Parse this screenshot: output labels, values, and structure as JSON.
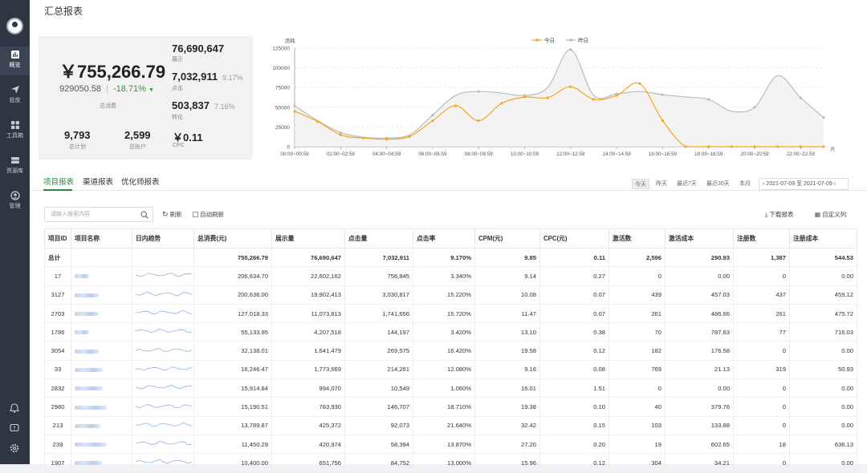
{
  "nav": {
    "items": [
      {
        "label": "概览",
        "icon": "bar-chart-icon"
      },
      {
        "label": "投放",
        "icon": "send-icon"
      },
      {
        "label": "工具箱",
        "icon": "grid-icon"
      },
      {
        "label": "资源库",
        "icon": "database-icon"
      },
      {
        "label": "管理",
        "icon": "user-circle-icon"
      }
    ]
  },
  "header": {
    "title": "汇总报表"
  },
  "kpi": {
    "total_spend": "￥755,266.79",
    "compare_value": "929050.58",
    "separator": "|",
    "change": "-18.71%",
    "spend_label": "总消费",
    "impressions": "76,690,647",
    "impressions_label": "展示",
    "clicks": "7,032,911",
    "clicks_pct": "9.17%",
    "clicks_label": "点击",
    "conversions": "503,837",
    "conversions_pct": "7.16%",
    "conversions_label": "转化",
    "plans": "9,793",
    "plans_label": "总计划",
    "accounts": "2,599",
    "accounts_label": "总账户",
    "cpc": "￥0.11",
    "cpc_label": "CPC"
  },
  "chart_data": {
    "type": "line",
    "ylabel": "消耗",
    "xlabel": "时间",
    "ylim": [
      0,
      125000
    ],
    "yticks": [
      "0",
      "25000",
      "50000",
      "75000",
      "100000",
      "125000"
    ],
    "categories": [
      "00:00~00:59",
      "01:00~01:59",
      "02:00~02:59",
      "03:00~03:59",
      "04:00~04:59",
      "05:00~05:59",
      "06:00~06:59",
      "07:00~07:59",
      "08:00~08:59",
      "09:00~09:59",
      "10:00~10:59",
      "11:00~11:59",
      "12:00~12:59",
      "13:00~13:59",
      "14:00~14:59",
      "15:00~15:59",
      "16:00~16:59",
      "17:00~17:59",
      "18:00~18:59",
      "19:00~19:59",
      "20:00~20:59",
      "21:00~21:59",
      "22:00~22:59",
      "23:00~23:59"
    ],
    "xtick_labels": [
      "00:00~00:59",
      "02:00~02:59",
      "04:00~04:59",
      "06:00~06:59",
      "08:00~08:59",
      "10:00~10:59",
      "12:00~12:59",
      "14:00~14:59",
      "16:00~16:59",
      "18:00~18:59",
      "20:00~20:59",
      "22:00~22:59"
    ],
    "legend_position": "top-center",
    "series": [
      {
        "name": "今日",
        "color": "#f5a623",
        "values": [
          45000,
          32000,
          15000,
          11000,
          9500,
          13000,
          33000,
          52000,
          33000,
          55000,
          63000,
          62000,
          76000,
          60000,
          65000,
          80000,
          33000,
          0,
          0,
          0,
          0,
          0,
          0,
          0
        ]
      },
      {
        "name": "昨日",
        "color": "#bbbbbb",
        "values": [
          52000,
          33000,
          18000,
          12000,
          11000,
          15000,
          40000,
          65000,
          70000,
          68000,
          65000,
          75000,
          123000,
          65000,
          67000,
          70000,
          66000,
          63000,
          60000,
          45000,
          50000,
          90000,
          62000,
          37000
        ]
      }
    ]
  },
  "tabs": [
    "项目报表",
    "渠道报表",
    "优化师报表"
  ],
  "ranges": [
    "今天",
    "昨天",
    "最近7天",
    "最近30天",
    "本月"
  ],
  "date_range": "2021-07-09 至 2021-07-09",
  "toolbar": {
    "search_placeholder": "请输入搜索内容",
    "refresh": "刷新",
    "auto_refresh": "自动刷新",
    "download": "下载报表",
    "custom_columns": "自定义列"
  },
  "table": {
    "headers": [
      "项目ID",
      "项目名称",
      "日内趋势",
      "总消费(元)",
      "展示量",
      "点击量",
      "点击率",
      "CPM(元)",
      "CPC(元)",
      "激活数",
      "激活成本",
      "注册数",
      "注册成本"
    ],
    "total": [
      "总计",
      "",
      "",
      "755,266.79",
      "76,690,647",
      "7,032,911",
      "9.170%",
      "9.85",
      "0.11",
      "2,596",
      "290.93",
      "1,387",
      "544.53"
    ],
    "rows": [
      [
        "17",
        "",
        "",
        "206,634.70",
        "22,602,162",
        "756,845",
        "3.340%",
        "9.14",
        "0.27",
        "0",
        "0.00",
        "0",
        "0.00"
      ],
      [
        "3127",
        "",
        "",
        "200,636.00",
        "19,902,413",
        "3,030,817",
        "15.220%",
        "10.08",
        "0.07",
        "439",
        "457.03",
        "437",
        "459.12"
      ],
      [
        "2703",
        "",
        "",
        "127,018.33",
        "11,073,813",
        "1,741,656",
        "15.720%",
        "11.47",
        "0.07",
        "261",
        "486.66",
        "261",
        "475.72"
      ],
      [
        "1786",
        "",
        "",
        "55,133.95",
        "4,207,518",
        "144,197",
        "3.420%",
        "13.10",
        "0.38",
        "70",
        "787.63",
        "77",
        "716.03"
      ],
      [
        "3054",
        "",
        "",
        "32,138.01",
        "1,641,479",
        "269,575",
        "16.420%",
        "19.58",
        "0.12",
        "182",
        "176.58",
        "0",
        "0.00"
      ],
      [
        "33",
        "",
        "",
        "16,246.47",
        "1,773,669",
        "214,261",
        "12.080%",
        "9.16",
        "0.08",
        "769",
        "21.13",
        "319",
        "50.93"
      ],
      [
        "2832",
        "",
        "",
        "15,914.84",
        "994,070",
        "10,549",
        "1.060%",
        "16.01",
        "1.51",
        "0",
        "0.00",
        "0",
        "0.00"
      ],
      [
        "2980",
        "",
        "",
        "15,190.51",
        "783,930",
        "146,707",
        "18.710%",
        "19.38",
        "0.10",
        "40",
        "379.76",
        "0",
        "0.00"
      ],
      [
        "213",
        "",
        "",
        "13,789.87",
        "425,372",
        "92,073",
        "21.640%",
        "32.42",
        "0.15",
        "103",
        "133.88",
        "0",
        "0.00"
      ],
      [
        "239",
        "",
        "",
        "11,450.29",
        "420,974",
        "58,394",
        "13.870%",
        "27.20",
        "0.20",
        "19",
        "602.65",
        "18",
        "636.13"
      ],
      [
        "1907",
        "",
        "",
        "10,400.00",
        "651,756",
        "84,752",
        "13.000%",
        "15.96",
        "0.12",
        "304",
        "34.21",
        "0",
        "0.00"
      ]
    ]
  }
}
